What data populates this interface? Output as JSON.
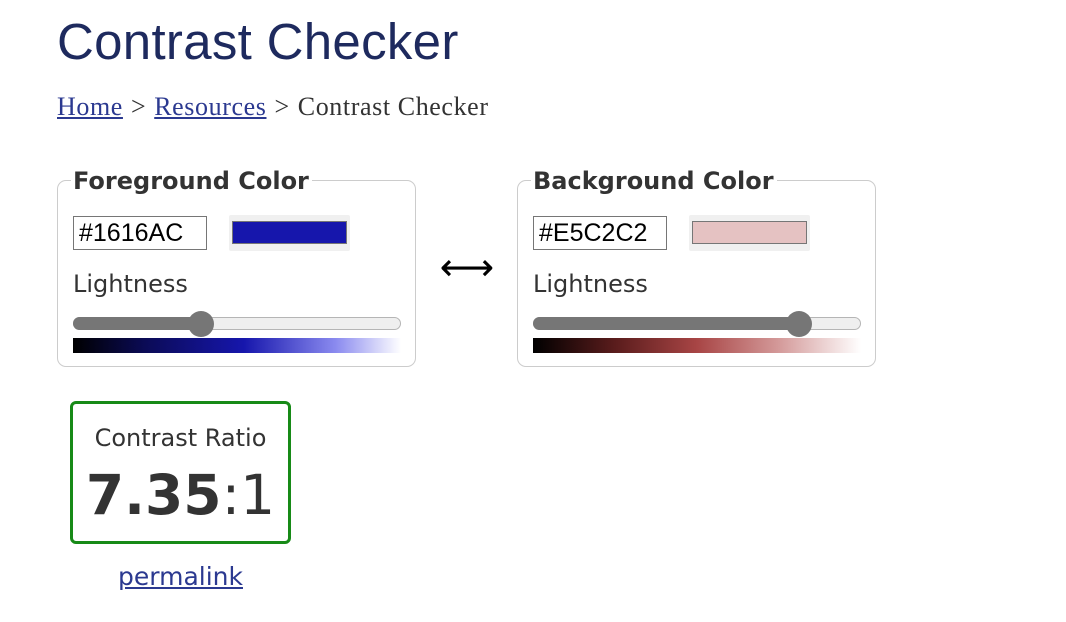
{
  "page": {
    "title": "Contrast Checker"
  },
  "breadcrumb": {
    "items": [
      {
        "label": "Home"
      },
      {
        "label": "Resources"
      },
      {
        "label": "Contrast Checker"
      }
    ],
    "separator": ">"
  },
  "foreground": {
    "legend": "Foreground Color",
    "hex_value": "#1616AC",
    "swatch_color": "#1616AC",
    "lightness_label": "Lightness",
    "lightness_value": 0.39
  },
  "background": {
    "legend": "Background Color",
    "hex_value": "#E5C2C2",
    "swatch_color": "#E5C2C2",
    "lightness_label": "Lightness",
    "lightness_value": 0.81
  },
  "swap": {
    "symbol": "⟷",
    "icon": "swap-arrows-icon"
  },
  "result": {
    "label": "Contrast Ratio",
    "ratio_value": "7.35",
    "ratio_suffix": ":1",
    "border_color": "#178A17"
  },
  "permalink": {
    "label": "permalink"
  },
  "colors": {
    "title": "#1E2A5E",
    "link": "#2B3990",
    "text": "#333333",
    "slider": "#767676"
  }
}
